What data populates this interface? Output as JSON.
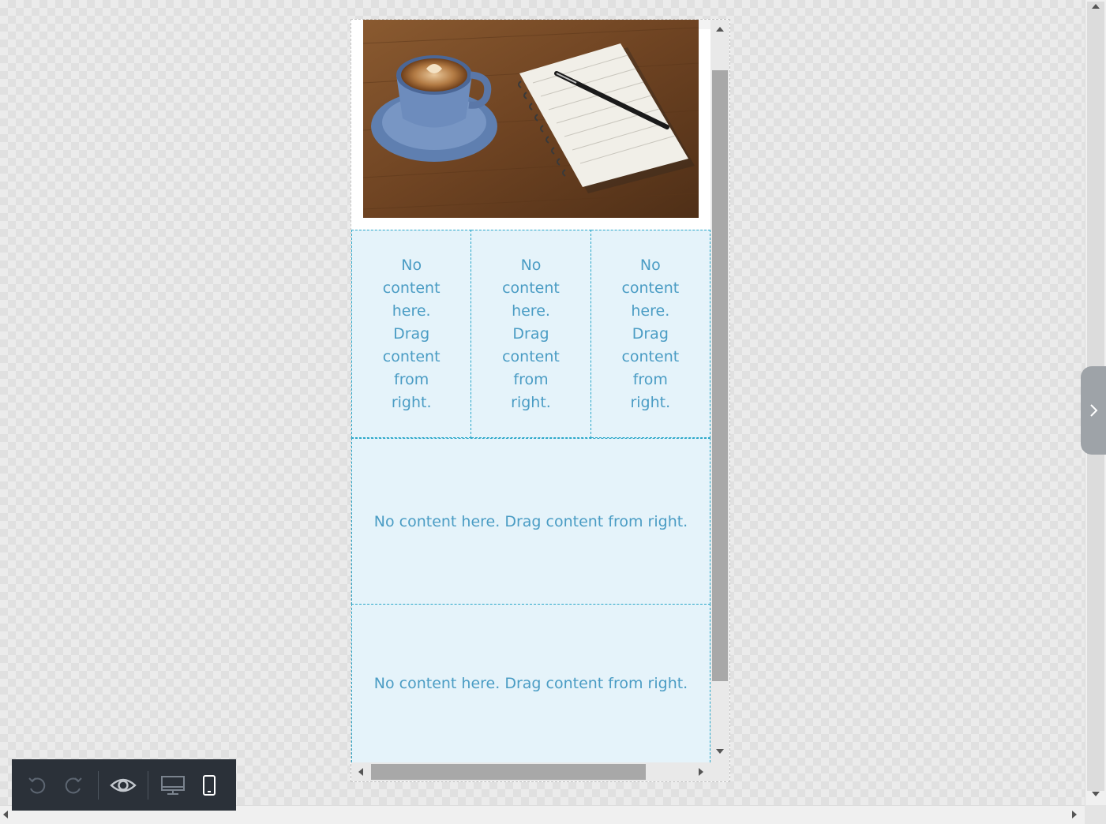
{
  "editor": {
    "placeholder_text": "No content here. Drag content from right.",
    "columns": [
      {
        "text": "No content here. Drag content from right."
      },
      {
        "text": "No content here. Drag content from right."
      },
      {
        "text": "No content here. Drag content from right."
      }
    ],
    "rows": [
      {
        "text": "No content here. Drag content from right."
      },
      {
        "text": "No content here. Drag content from right."
      }
    ],
    "hero_image": "coffee-cup-and-notebook"
  },
  "toolbar": {
    "buttons": [
      {
        "name": "undo-button",
        "icon": "undo-icon",
        "enabled": false
      },
      {
        "name": "redo-button",
        "icon": "redo-icon",
        "enabled": false
      },
      {
        "name": "preview-button",
        "icon": "eye-icon",
        "enabled": true
      },
      {
        "name": "desktop-view-button",
        "icon": "desktop-icon",
        "active": false
      },
      {
        "name": "mobile-view-button",
        "icon": "mobile-icon",
        "active": true
      }
    ]
  },
  "colors": {
    "drop_zone_bg": "#e5f3fa",
    "drop_zone_border": "#2aa7c9",
    "drop_zone_text": "#4a9cc4",
    "toolbar_bg": "#2b3139",
    "panel_toggle_bg": "#9ea3a8"
  }
}
